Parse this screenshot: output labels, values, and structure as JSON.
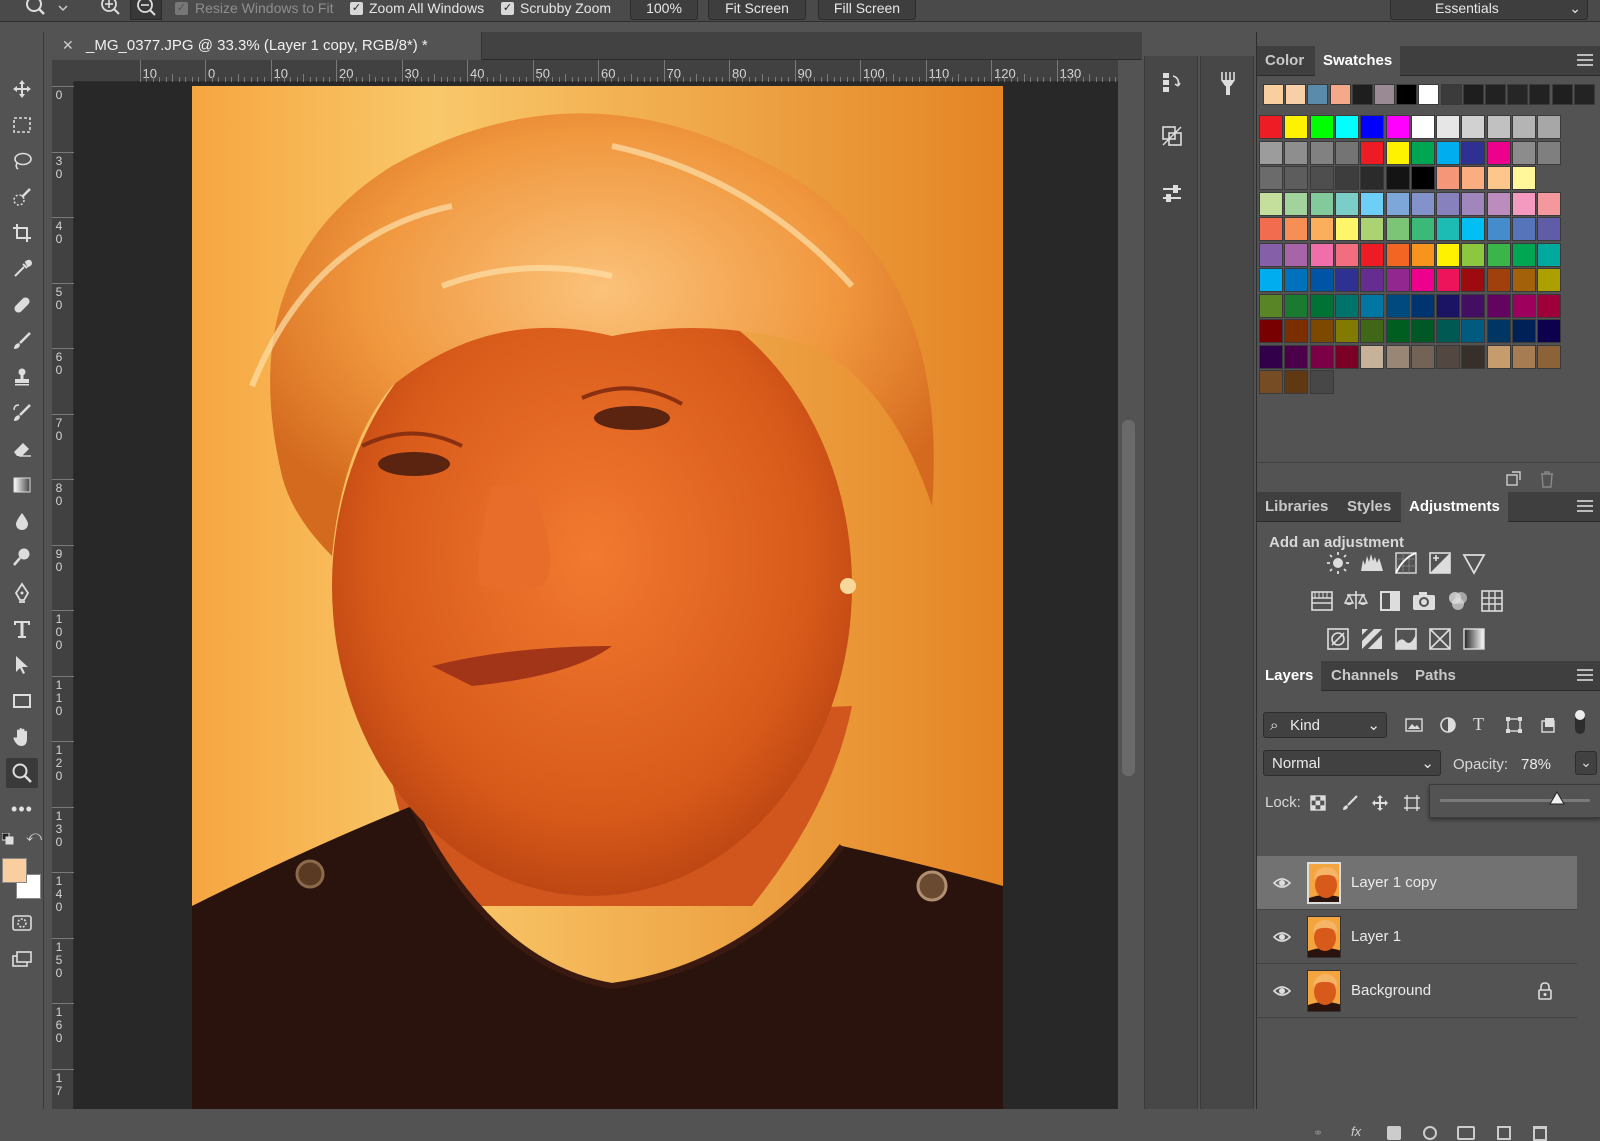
{
  "options_bar": {
    "resize_windows": "Resize Windows to Fit",
    "zoom_all": "Zoom All Windows",
    "scrubby_zoom": "Scrubby Zoom",
    "zoom_value": "100%",
    "fit_screen": "Fit Screen",
    "fill_screen": "Fill Screen",
    "workspace": "Essentials"
  },
  "document": {
    "tab_title": "_MG_0377.JPG @ 33.3% (Layer 1 copy, RGB/8*) *"
  },
  "ruler": {
    "h_ticks": [
      "0",
      "10",
      "0",
      "10",
      "20",
      "30",
      "40",
      "50",
      "60",
      "70",
      "80",
      "90",
      "100",
      "110",
      "120",
      "130"
    ],
    "v_ticks": [
      "0",
      "3\n0",
      "4\n0",
      "5\n0",
      "6\n0",
      "7\n0",
      "8\n0",
      "9\n0",
      "1\n0\n0",
      "1\n1\n0",
      "1\n2\n0",
      "1\n3\n0",
      "1\n4\n0",
      "1\n5\n0",
      "1\n6\n0",
      "1\n7"
    ]
  },
  "color_panel": {
    "tabs": [
      "Color",
      "Swatches"
    ],
    "active_tab": "Swatches",
    "recent_swatches": [
      "#f9cfa0",
      "#f7d0a8",
      "#5a8bab",
      "#f5a98a",
      "#1e1e1e",
      "#9a8a94",
      "#000000",
      "#ffffff",
      "#3b3b3b",
      "#1e1e1e",
      "#222222",
      "#262626",
      "#222222",
      "#1f1f1f",
      "#232323"
    ],
    "swatch_grid": [
      [
        "#ee1c24",
        "#fff200",
        "#00ff00",
        "#00ffff",
        "#0000ff",
        "#ff00ff",
        "#ffffff",
        "#e6e6e6",
        "#d1d1d1",
        "#c1c1c1",
        "#b4b4b4",
        "#a7a7a7"
      ],
      [
        "#9c9c9c",
        "#8e8e8e",
        "#818181",
        "#747474",
        "#ed1c24",
        "#fff200",
        "#00a651",
        "#00aeef",
        "#2e3192",
        "#ec008c",
        "#8c8c8c",
        "#7f7f7f"
      ],
      [
        "#6b6b6b",
        "#5d5d5d",
        "#4e4e4e",
        "#3d3d3d",
        "#2b2b2b",
        "#141414",
        "#000000",
        "#f69679",
        "#f9ad81",
        "#fdc68a",
        "#fff79a"
      ],
      [
        "#c4df9b",
        "#a3d39c",
        "#82ca9c",
        "#7bcdc8",
        "#6dcff6",
        "#7da7d9",
        "#8393ca",
        "#8781bd",
        "#a186be",
        "#bd8cbf",
        "#f49ac1",
        "#f5989d"
      ],
      [
        "#f26c4f",
        "#f68e56",
        "#fbaf5d",
        "#fff568",
        "#acd373",
        "#7cc576",
        "#3cb878",
        "#1cbbb4",
        "#00bff3",
        "#448ccb",
        "#5574b9",
        "#605ca8"
      ],
      [
        "#8560a8",
        "#a864a8",
        "#f06eaa",
        "#f26d7d",
        "#ed1c24",
        "#f26522",
        "#f7941d",
        "#fff200",
        "#8dc73f",
        "#39b54a",
        "#00a651",
        "#00a99d"
      ],
      [
        "#00aeef",
        "#0072bc",
        "#0054a6",
        "#2e3192",
        "#662d91",
        "#92278f",
        "#ec008c",
        "#ed145b",
        "#9e0b0f",
        "#a0410d",
        "#a36209",
        "#aba000"
      ],
      [
        "#598527",
        "#1a7b30",
        "#007236",
        "#00746b",
        "#0076a3",
        "#004a80",
        "#003471",
        "#1b1464",
        "#440e62",
        "#630460",
        "#9e005d",
        "#9e0039"
      ],
      [
        "#790000",
        "#7b2e00",
        "#7d4900",
        "#827b00",
        "#406618",
        "#005e20",
        "#005826",
        "#005952",
        "#005b7f",
        "#003663",
        "#002157",
        "#0d004c"
      ],
      [
        "#32004b",
        "#4b0049",
        "#7b0046",
        "#7a0026",
        "#c7b299",
        "#998675",
        "#736357",
        "#534741",
        "#37302a",
        "#c69c6d",
        "#a67c52",
        "#8c6239"
      ],
      [
        "#754c24",
        "#603913",
        "#474747"
      ]
    ]
  },
  "adjustments_panel": {
    "tabs": [
      "Libraries",
      "Styles",
      "Adjustments"
    ],
    "active_tab": "Adjustments",
    "heading": "Add an adjustment"
  },
  "layers_panel": {
    "tabs": [
      "Layers",
      "Channels",
      "Paths"
    ],
    "active_tab": "Layers",
    "filter_kind": "Kind",
    "blend_mode": "Normal",
    "opacity_label": "Opacity:",
    "opacity_value": "78%",
    "opacity_fraction": 0.78,
    "lock_label": "Lock:",
    "layers": [
      {
        "name": "Layer 1 copy",
        "selected": true,
        "locked": false
      },
      {
        "name": "Layer 1",
        "selected": false,
        "locked": false
      },
      {
        "name": "Background",
        "selected": false,
        "locked": true
      }
    ]
  },
  "colors": {
    "foreground": "#f9cfa0",
    "background": "#ffffff"
  }
}
